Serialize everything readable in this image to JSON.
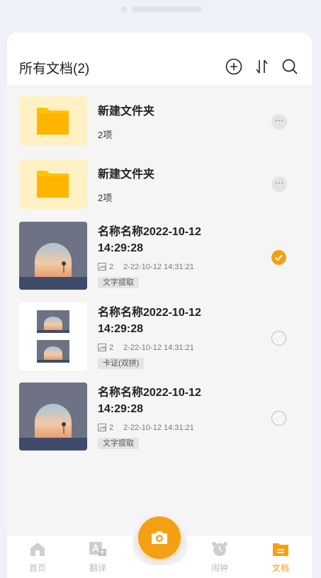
{
  "header": {
    "title": "所有文档(2)"
  },
  "icons": {
    "add": "plus-circle-icon",
    "sort": "sort-icon",
    "search": "search-icon"
  },
  "folders": [
    {
      "name": "新建文件夹",
      "count": "2项"
    },
    {
      "name": "新建文件夹",
      "count": "2项"
    }
  ],
  "documents": [
    {
      "name_line1": "名称名称2022-10-12",
      "name_line2": "14:29:28",
      "page_count": "2",
      "date": "2-22-10-12  14:31:21",
      "tag": "文字提取",
      "selected": true
    },
    {
      "name_line1": "名称名称2022-10-12",
      "name_line2": "14:29:28",
      "page_count": "2",
      "date": "2-22-10-12  14:31:21",
      "tag": "卡证(双拼)",
      "selected": false
    },
    {
      "name_line1": "名称名称2022-10-12",
      "name_line2": "14:29:28",
      "page_count": "2",
      "date": "2-22-10-12  14:31:21",
      "tag": "文字提取",
      "selected": false
    }
  ],
  "more_glyph": "···",
  "bottom_nav": {
    "home": "首页",
    "translate": "翻译",
    "alarm": "闹钟",
    "docs": "文档"
  },
  "colors": {
    "accent": "#f5a012",
    "folder": "#ffc200",
    "folder_bg": "#fff1c4"
  }
}
